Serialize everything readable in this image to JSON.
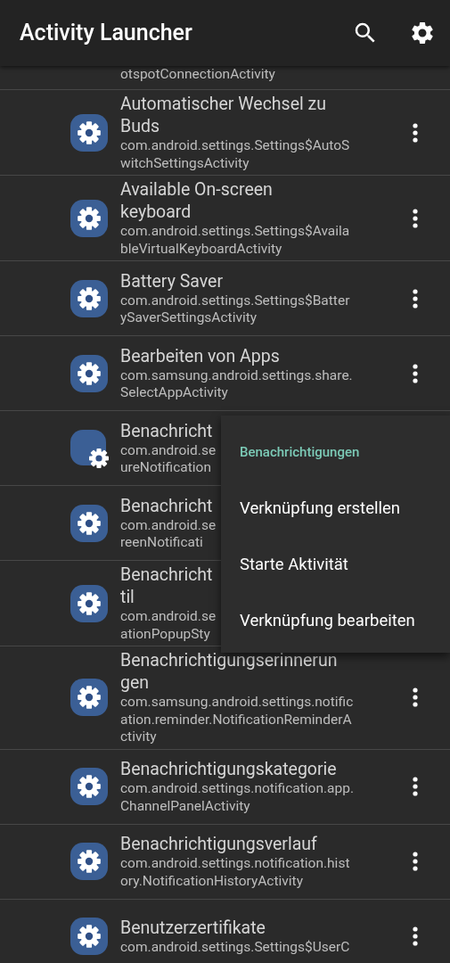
{
  "app_bar": {
    "title": "Activity Launcher"
  },
  "rows": [
    {
      "kind": "partial",
      "package": "otspotConnectionActivity",
      "menu_button": false
    },
    {
      "kind": "gear",
      "title": "Automatischer Wechsel zu\nBuds",
      "package": "com.android.settings.Settings$AutoS\nwitchSettingsActivity",
      "menu_button": true
    },
    {
      "kind": "gear",
      "title": "Available On-screen\nkeyboard",
      "package": "com.android.settings.Settings$Availa\nbleVirtualKeyboardActivity",
      "menu_button": true
    },
    {
      "kind": "gear",
      "title": "Battery Saver",
      "package": "com.android.settings.Settings$Batter\nySaverSettingsActivity",
      "menu_button": true
    },
    {
      "kind": "gear",
      "title": "Bearbeiten von Apps",
      "package": "com.samsung.android.settings.share.\nSelectAppActivity",
      "menu_button": true
    },
    {
      "kind": "corner-gear",
      "title": "Benachricht",
      "package": "com.android.se\nureNotification",
      "menu_button": false
    },
    {
      "kind": "gear",
      "title": "Benachricht",
      "package": "com.android.se\nreenNotificati",
      "menu_button": false
    },
    {
      "kind": "gear",
      "title": "Benachricht\ntil",
      "package": "com.android.se\nationPopupSty",
      "menu_button": false
    },
    {
      "kind": "gear",
      "title": "Benachrichtigungserinnerun\ngen",
      "package": "com.samsung.android.settings.notific\nation.reminder.NotificationReminderA\nctivity",
      "menu_button": true
    },
    {
      "kind": "gear",
      "title": "Benachrichtigungskategorie",
      "package": "com.android.settings.notification.app.\nChannelPanelActivity",
      "menu_button": true
    },
    {
      "kind": "gear",
      "title": "Benachrichtigungsverlauf",
      "package": "com.android.settings.notification.hist\nory.NotificationHistoryActivity",
      "menu_button": true
    },
    {
      "kind": "gear",
      "title": "Benutzerzertifikate",
      "package": "com.android.settings.Settings$UserC",
      "menu_button": true
    }
  ],
  "popup_menu": {
    "header": "Benachrichtigungen",
    "items": [
      "Verknüpfung erstellen",
      "Starte Aktivität",
      "Verknüpfung bearbeiten"
    ]
  }
}
